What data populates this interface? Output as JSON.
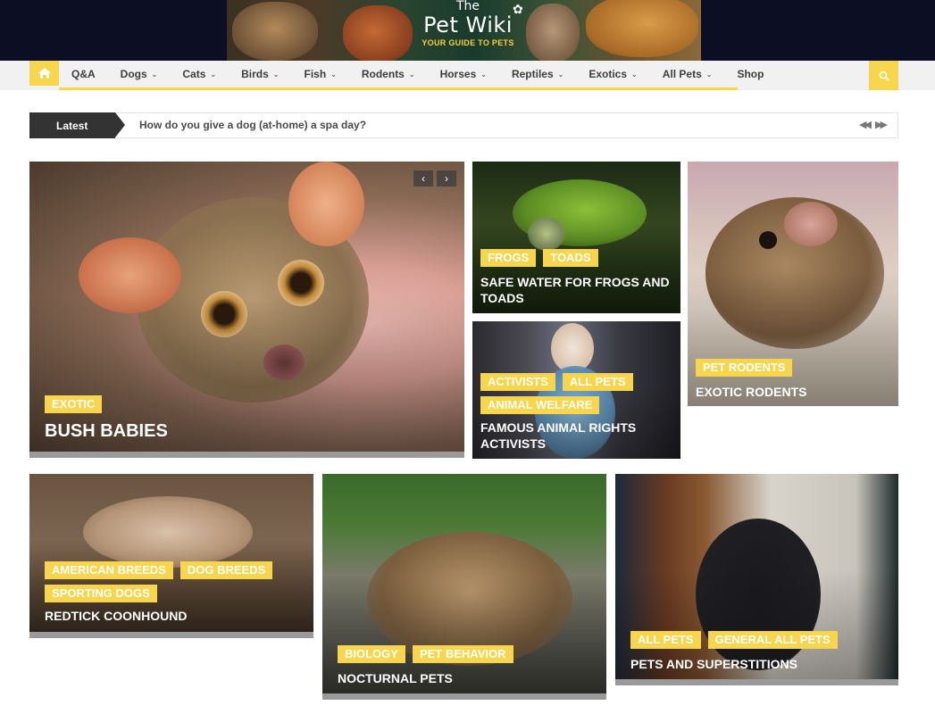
{
  "header": {
    "banner_the": "The",
    "banner_name": "Pet Wiki",
    "banner_tagline": "YOUR GUIDE TO PETS"
  },
  "nav": {
    "home_icon": "home-icon",
    "search_icon": "search-icon",
    "items": [
      {
        "label": "Q&A",
        "dropdown": false
      },
      {
        "label": "Dogs",
        "dropdown": true
      },
      {
        "label": "Cats",
        "dropdown": true
      },
      {
        "label": "Birds",
        "dropdown": true
      },
      {
        "label": "Fish",
        "dropdown": true
      },
      {
        "label": "Rodents",
        "dropdown": true
      },
      {
        "label": "Horses",
        "dropdown": true
      },
      {
        "label": "Reptiles",
        "dropdown": true
      },
      {
        "label": "Exotics",
        "dropdown": true
      },
      {
        "label": "All Pets",
        "dropdown": true
      },
      {
        "label": "Shop",
        "dropdown": false
      }
    ]
  },
  "ticker": {
    "label": "Latest",
    "headline": "How do you give a dog (at-home) a spa day?"
  },
  "featured": {
    "main": {
      "tags": [
        "EXOTIC"
      ],
      "title": "BUSH BABIES"
    },
    "frogs": {
      "tags": [
        "FROGS",
        "TOADS"
      ],
      "title": "SAFE WATER FOR FROGS AND TOADS"
    },
    "activists": {
      "tags": [
        "ACTIVISTS",
        "ALL PETS",
        "ANIMAL WELFARE"
      ],
      "title": "FAMOUS ANIMAL RIGHTS ACTIVISTS"
    },
    "rodents": {
      "tags": [
        "PET RODENTS"
      ],
      "title": "EXOTIC RODENTS"
    }
  },
  "bottom": {
    "coonhound": {
      "tags": [
        "AMERICAN BREEDS",
        "DOG BREEDS",
        "SPORTING DOGS"
      ],
      "title": "REDTICK COONHOUND"
    },
    "nocturnal": {
      "tags": [
        "BIOLOGY",
        "PET BEHAVIOR"
      ],
      "title": "NOCTURNAL PETS"
    },
    "superstitions": {
      "tags": [
        "ALL PETS",
        "GENERAL ALL PETS"
      ],
      "title": "PETS AND SUPERSTITIONS"
    }
  },
  "colors": {
    "accent": "#f7d54c",
    "header_bg": "#0c0f24",
    "nav_bg": "#f1f1f1",
    "ticker_label_bg": "#333333"
  }
}
